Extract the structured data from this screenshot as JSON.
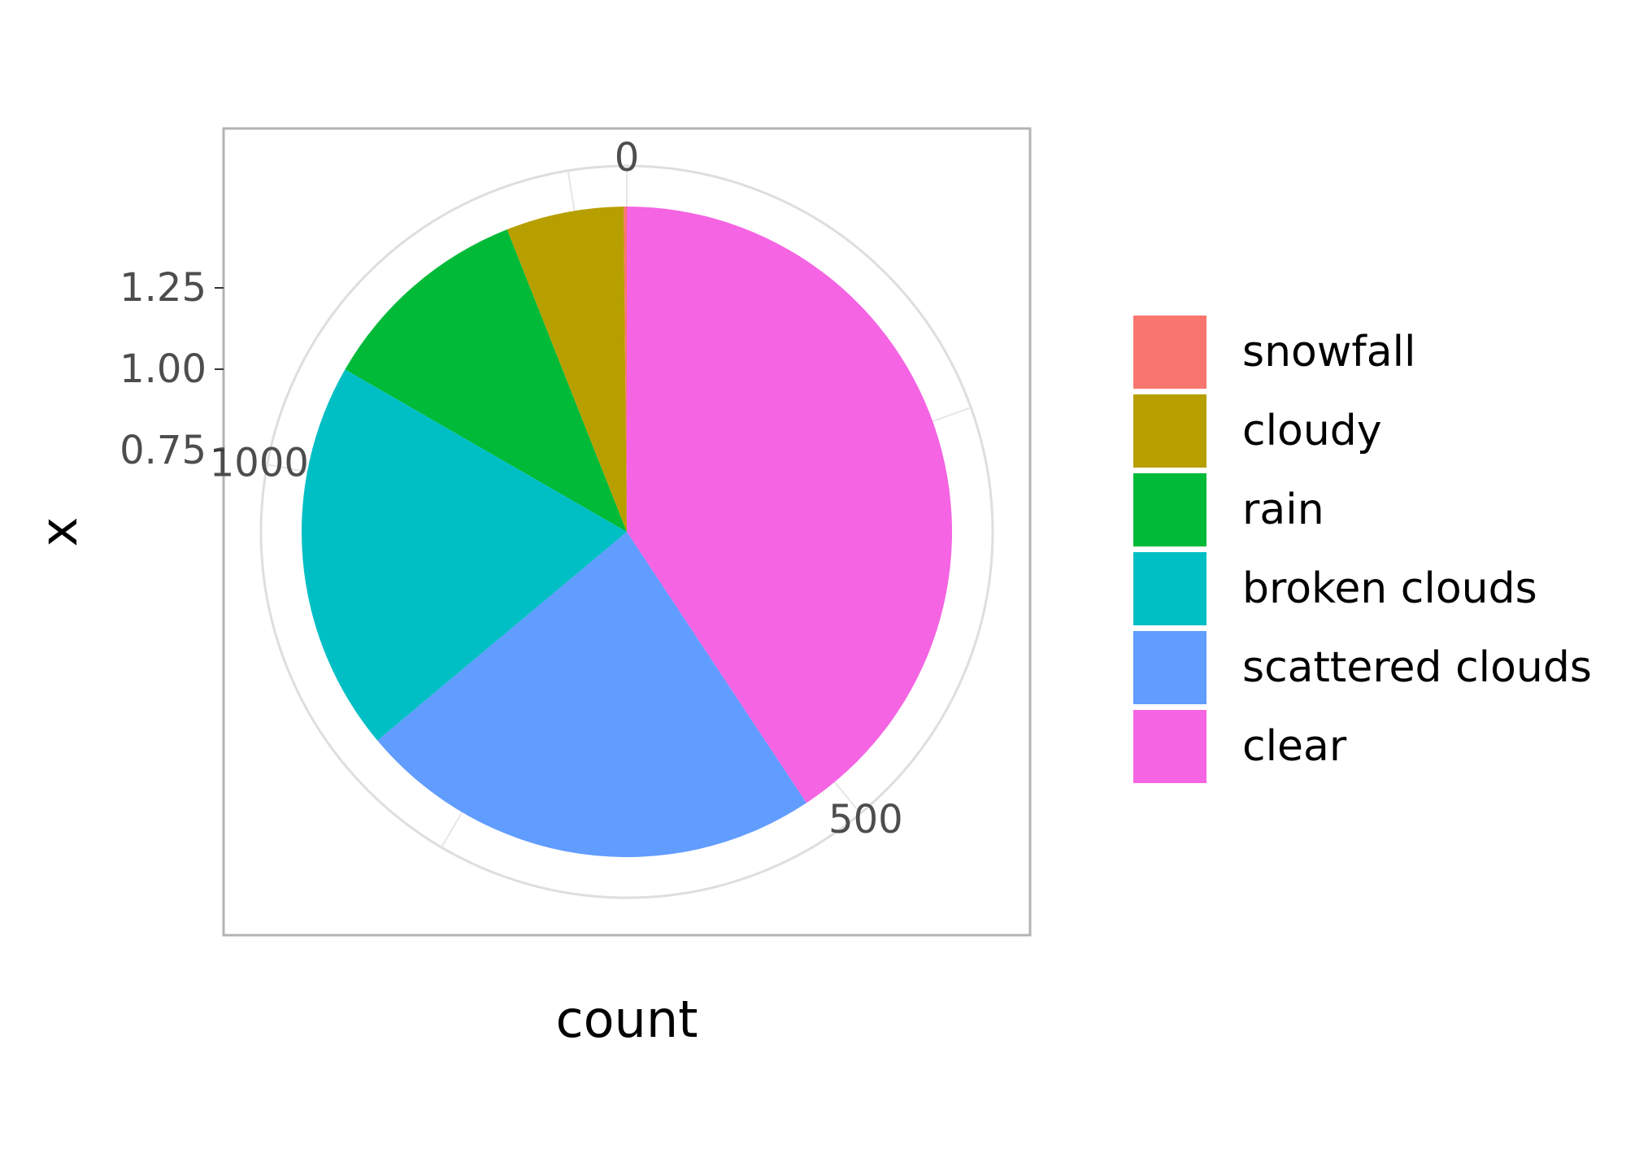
{
  "chart_data": {
    "type": "pie",
    "categories": [
      "snowfall",
      "cloudy",
      "rain",
      "broken clouds",
      "scattered clouds",
      "clear"
    ],
    "values": [
      2,
      75,
      137,
      249,
      298,
      522
    ],
    "colors": [
      "#F8766D",
      "#B79F00",
      "#00BA38",
      "#00BFC4",
      "#619CFF",
      "#F564E3"
    ],
    "xlabel": "count",
    "ylabel": "x",
    "radial_ticks": [
      {
        "value": 0,
        "label": "0"
      },
      {
        "value": 500,
        "label": "500"
      },
      {
        "value": 1000,
        "label": "1000"
      }
    ],
    "y_ticks": [
      {
        "value": 1.25,
        "label": "1.25"
      },
      {
        "value": 1.0,
        "label": "1.00"
      },
      {
        "value": 0.75,
        "label": "0.75"
      }
    ],
    "y_range": [
      0.5,
      1.5
    ],
    "legend": {
      "position": "right",
      "order": [
        "snowfall",
        "cloudy",
        "rain",
        "broken clouds",
        "scattered clouds",
        "clear"
      ]
    },
    "grid": true
  }
}
